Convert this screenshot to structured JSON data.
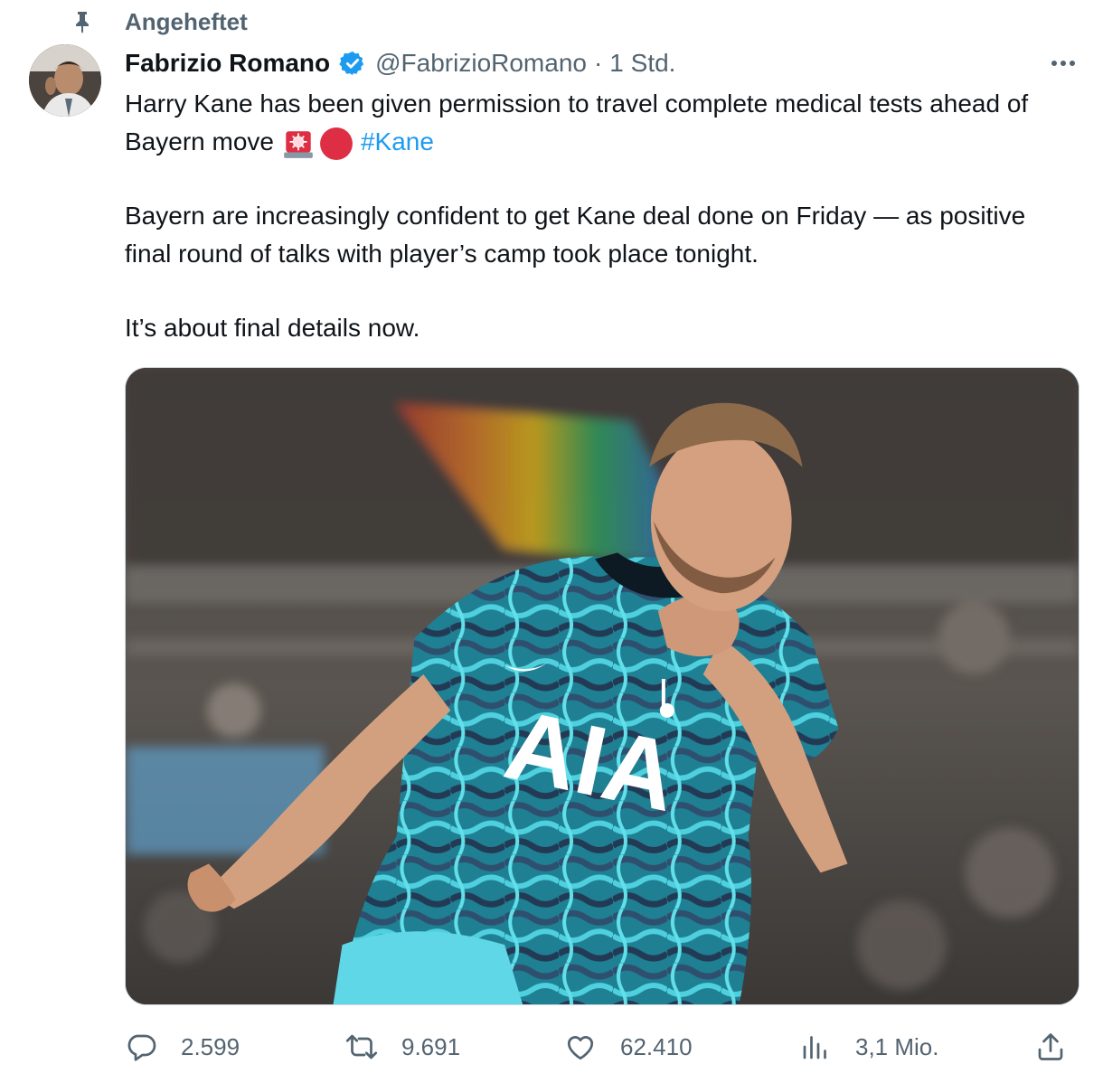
{
  "pinned": {
    "label": "Angeheftet",
    "icon": "pin-icon"
  },
  "author": {
    "display_name": "Fabrizio Romano",
    "handle": "@FabrizioRomano",
    "separator": "·",
    "time": "1 Std.",
    "verified": true
  },
  "tweet": {
    "line1": "Harry Kane has been given permission to travel complete medical tests ahead of Bayern move",
    "emojis": [
      "siren-emoji",
      "red-circle-emoji"
    ],
    "hashtag": "#Kane",
    "paragraph2": "Bayern are increasingly confident to get Kane deal done on Friday — as positive final round of talks with player’s camp took place tonight.",
    "paragraph3": "It’s about final details now."
  },
  "media": {
    "shirt_sponsor": "AIA"
  },
  "actions": {
    "replies": "2.599",
    "retweets": "9.691",
    "likes": "62.410",
    "views": "3,1 Mio."
  },
  "colors": {
    "accent": "#1d9bf0",
    "secondary_text": "#536471",
    "primary_text": "#0f1419",
    "border": "#cfd9de"
  }
}
